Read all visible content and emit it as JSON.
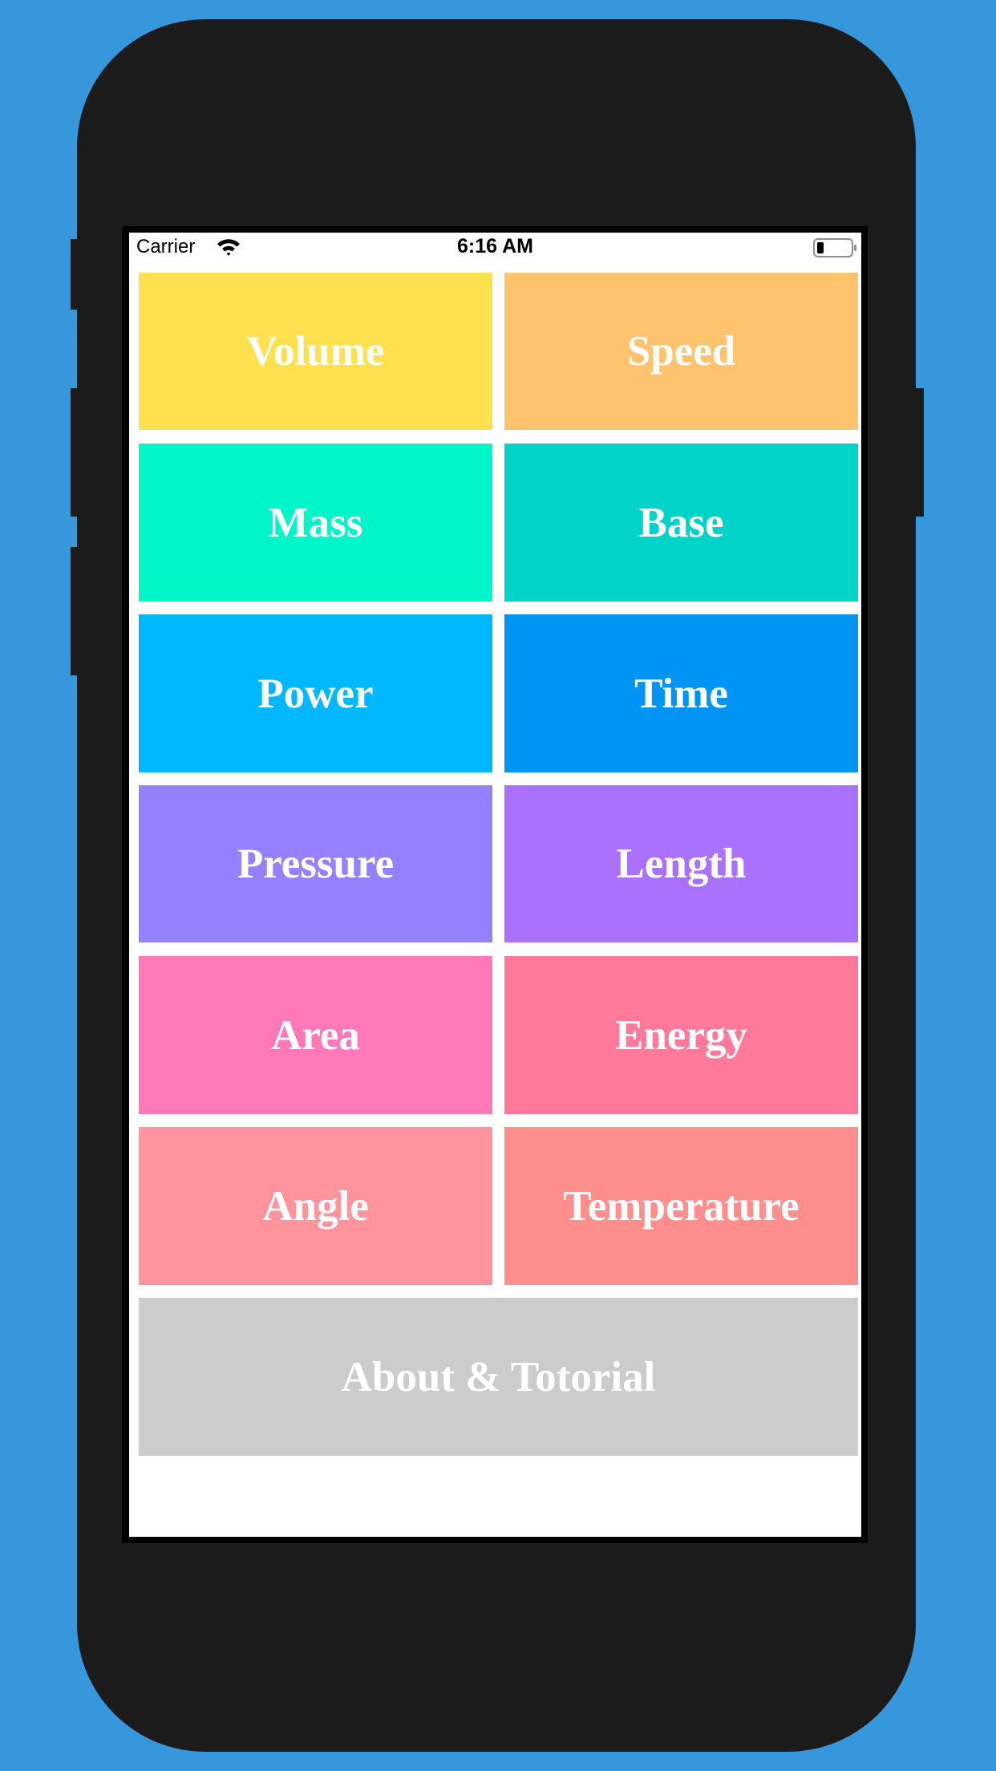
{
  "status_bar": {
    "carrier": "Carrier",
    "time": "6:16 AM"
  },
  "icons": {
    "wifi": "wifi-icon",
    "battery": "battery-icon"
  },
  "tiles": [
    {
      "label": "Volume",
      "color": "#FFE04E"
    },
    {
      "label": "Speed",
      "color": "#FFC36E"
    },
    {
      "label": "Mass",
      "color": "#00F5C8"
    },
    {
      "label": "Base",
      "color": "#00D3C7"
    },
    {
      "label": "Power",
      "color": "#00B8FF"
    },
    {
      "label": "Time",
      "color": "#0095F4"
    },
    {
      "label": "Pressure",
      "color": "#9580FF"
    },
    {
      "label": "Length",
      "color": "#AA71FF"
    },
    {
      "label": "Area",
      "color": "#FF79B8"
    },
    {
      "label": "Energy",
      "color": "#FF7A9A"
    },
    {
      "label": "Angle",
      "color": "#FF949D"
    },
    {
      "label": "Temperature",
      "color": "#FF8E8C"
    }
  ],
  "about": {
    "label": "About & Totorial",
    "color": "#CCCCCC"
  },
  "colors": {
    "background": "#3797DC",
    "phone_body": "#1B1B1B",
    "screen": "#FFFFFF"
  }
}
